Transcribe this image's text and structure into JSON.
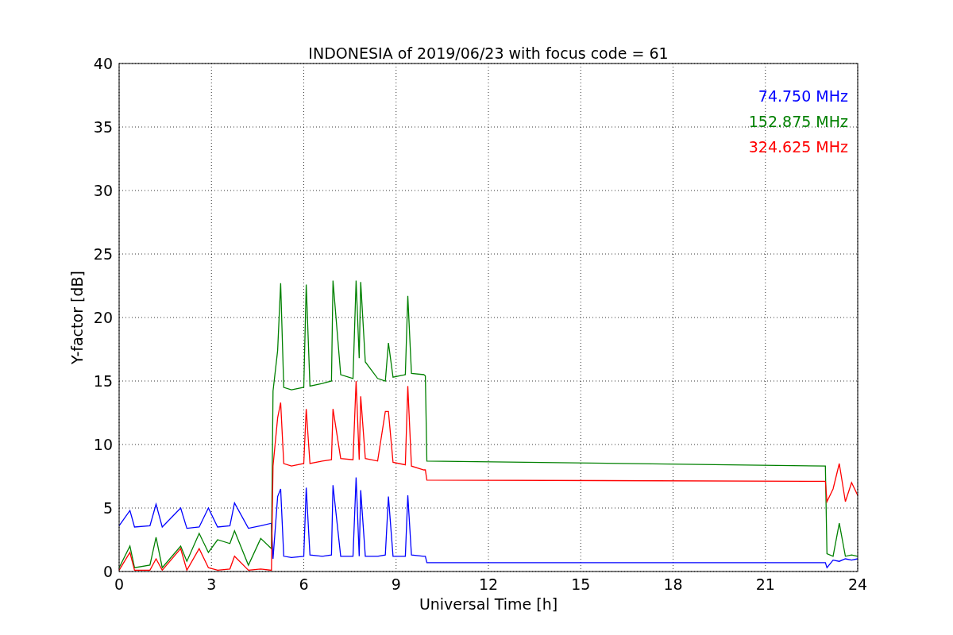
{
  "figure": {
    "chart_data": {
      "type": "line",
      "title": "INDONESIA of 2019/06/23 with focus code = 61",
      "xlabel": "Universal Time [h]",
      "ylabel": "Y-factor [dB]",
      "x": [
        0,
        0.35,
        0.5,
        1.0,
        1.2,
        1.4,
        2.0,
        2.2,
        2.6,
        2.9,
        3.2,
        3.6,
        3.75,
        4.2,
        4.6,
        4.95,
        5.0,
        5.15,
        5.25,
        5.35,
        5.6,
        6.0,
        6.08,
        6.2,
        6.6,
        6.9,
        6.95,
        7.2,
        7.6,
        7.7,
        7.8,
        7.85,
        8.0,
        8.4,
        8.65,
        8.75,
        8.9,
        9.3,
        9.38,
        9.5,
        9.9,
        9.95,
        10.0,
        22.95,
        23.0,
        23.2,
        23.4,
        23.6,
        23.8,
        24.0
      ],
      "series": [
        {
          "name": "74.750 MHz",
          "color": "#0000ff",
          "values": [
            3.6,
            4.8,
            3.5,
            3.6,
            5.3,
            3.5,
            5.0,
            3.4,
            3.5,
            5.0,
            3.5,
            3.6,
            5.4,
            3.4,
            3.6,
            3.8,
            1.0,
            5.9,
            6.5,
            1.2,
            1.1,
            1.2,
            6.6,
            1.3,
            1.2,
            1.3,
            6.8,
            1.2,
            1.2,
            7.4,
            1.2,
            6.4,
            1.2,
            1.2,
            1.3,
            5.9,
            1.2,
            1.2,
            6.0,
            1.3,
            1.2,
            1.2,
            0.7,
            0.7,
            0.3,
            0.9,
            0.8,
            1.0,
            0.9,
            1.0
          ]
        },
        {
          "name": "152.875 MHz",
          "color": "#008000",
          "values": [
            0.3,
            2.0,
            0.3,
            0.5,
            2.7,
            0.3,
            2.0,
            0.8,
            3.0,
            1.5,
            2.5,
            2.2,
            3.2,
            0.5,
            2.6,
            1.8,
            14.2,
            17.4,
            22.7,
            14.5,
            14.3,
            14.5,
            22.6,
            14.6,
            14.8,
            15.0,
            22.9,
            15.5,
            15.2,
            22.9,
            16.8,
            22.8,
            16.5,
            15.2,
            15.0,
            18.0,
            15.3,
            15.5,
            21.7,
            15.6,
            15.5,
            15.4,
            8.7,
            8.3,
            1.4,
            1.2,
            3.8,
            1.2,
            1.3,
            1.2
          ]
        },
        {
          "name": "324.625 MHz",
          "color": "#ff0000",
          "values": [
            0.1,
            1.5,
            0.1,
            0.1,
            1.0,
            0.1,
            1.8,
            0.1,
            1.8,
            0.3,
            0.1,
            0.2,
            1.2,
            0.1,
            0.2,
            0.1,
            8.3,
            12.1,
            13.3,
            8.5,
            8.3,
            8.5,
            12.8,
            8.5,
            8.7,
            8.8,
            12.8,
            8.9,
            8.8,
            15.0,
            8.8,
            13.8,
            8.9,
            8.7,
            12.6,
            12.6,
            8.6,
            8.4,
            14.6,
            8.3,
            8.0,
            8.0,
            7.2,
            7.1,
            5.5,
            6.5,
            8.5,
            5.5,
            7.0,
            6.0
          ]
        }
      ],
      "xlim": [
        0,
        24
      ],
      "ylim": [
        0,
        40
      ],
      "xticks": [
        0,
        3,
        6,
        9,
        12,
        15,
        18,
        21,
        24
      ],
      "yticks": [
        0,
        5,
        10,
        15,
        20,
        25,
        30,
        35,
        40
      ],
      "grid": true
    }
  }
}
